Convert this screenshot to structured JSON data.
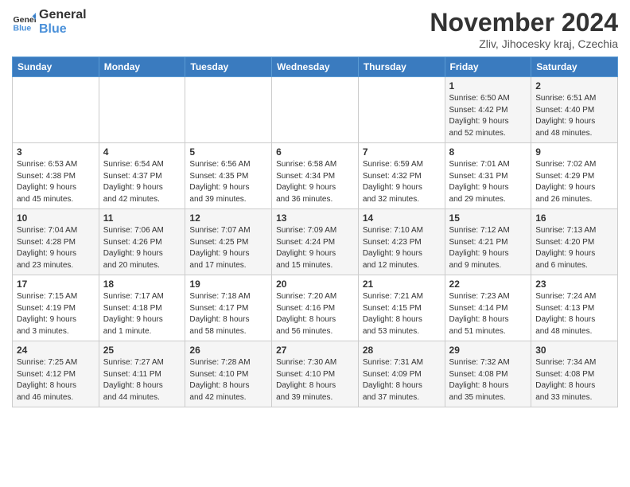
{
  "header": {
    "logo_line1": "General",
    "logo_line2": "Blue",
    "month": "November 2024",
    "location": "Zliv, Jihocesky kraj, Czechia"
  },
  "weekdays": [
    "Sunday",
    "Monday",
    "Tuesday",
    "Wednesday",
    "Thursday",
    "Friday",
    "Saturday"
  ],
  "weeks": [
    [
      {
        "day": "",
        "info": ""
      },
      {
        "day": "",
        "info": ""
      },
      {
        "day": "",
        "info": ""
      },
      {
        "day": "",
        "info": ""
      },
      {
        "day": "",
        "info": ""
      },
      {
        "day": "1",
        "info": "Sunrise: 6:50 AM\nSunset: 4:42 PM\nDaylight: 9 hours\nand 52 minutes."
      },
      {
        "day": "2",
        "info": "Sunrise: 6:51 AM\nSunset: 4:40 PM\nDaylight: 9 hours\nand 48 minutes."
      }
    ],
    [
      {
        "day": "3",
        "info": "Sunrise: 6:53 AM\nSunset: 4:38 PM\nDaylight: 9 hours\nand 45 minutes."
      },
      {
        "day": "4",
        "info": "Sunrise: 6:54 AM\nSunset: 4:37 PM\nDaylight: 9 hours\nand 42 minutes."
      },
      {
        "day": "5",
        "info": "Sunrise: 6:56 AM\nSunset: 4:35 PM\nDaylight: 9 hours\nand 39 minutes."
      },
      {
        "day": "6",
        "info": "Sunrise: 6:58 AM\nSunset: 4:34 PM\nDaylight: 9 hours\nand 36 minutes."
      },
      {
        "day": "7",
        "info": "Sunrise: 6:59 AM\nSunset: 4:32 PM\nDaylight: 9 hours\nand 32 minutes."
      },
      {
        "day": "8",
        "info": "Sunrise: 7:01 AM\nSunset: 4:31 PM\nDaylight: 9 hours\nand 29 minutes."
      },
      {
        "day": "9",
        "info": "Sunrise: 7:02 AM\nSunset: 4:29 PM\nDaylight: 9 hours\nand 26 minutes."
      }
    ],
    [
      {
        "day": "10",
        "info": "Sunrise: 7:04 AM\nSunset: 4:28 PM\nDaylight: 9 hours\nand 23 minutes."
      },
      {
        "day": "11",
        "info": "Sunrise: 7:06 AM\nSunset: 4:26 PM\nDaylight: 9 hours\nand 20 minutes."
      },
      {
        "day": "12",
        "info": "Sunrise: 7:07 AM\nSunset: 4:25 PM\nDaylight: 9 hours\nand 17 minutes."
      },
      {
        "day": "13",
        "info": "Sunrise: 7:09 AM\nSunset: 4:24 PM\nDaylight: 9 hours\nand 15 minutes."
      },
      {
        "day": "14",
        "info": "Sunrise: 7:10 AM\nSunset: 4:23 PM\nDaylight: 9 hours\nand 12 minutes."
      },
      {
        "day": "15",
        "info": "Sunrise: 7:12 AM\nSunset: 4:21 PM\nDaylight: 9 hours\nand 9 minutes."
      },
      {
        "day": "16",
        "info": "Sunrise: 7:13 AM\nSunset: 4:20 PM\nDaylight: 9 hours\nand 6 minutes."
      }
    ],
    [
      {
        "day": "17",
        "info": "Sunrise: 7:15 AM\nSunset: 4:19 PM\nDaylight: 9 hours\nand 3 minutes."
      },
      {
        "day": "18",
        "info": "Sunrise: 7:17 AM\nSunset: 4:18 PM\nDaylight: 9 hours\nand 1 minute."
      },
      {
        "day": "19",
        "info": "Sunrise: 7:18 AM\nSunset: 4:17 PM\nDaylight: 8 hours\nand 58 minutes."
      },
      {
        "day": "20",
        "info": "Sunrise: 7:20 AM\nSunset: 4:16 PM\nDaylight: 8 hours\nand 56 minutes."
      },
      {
        "day": "21",
        "info": "Sunrise: 7:21 AM\nSunset: 4:15 PM\nDaylight: 8 hours\nand 53 minutes."
      },
      {
        "day": "22",
        "info": "Sunrise: 7:23 AM\nSunset: 4:14 PM\nDaylight: 8 hours\nand 51 minutes."
      },
      {
        "day": "23",
        "info": "Sunrise: 7:24 AM\nSunset: 4:13 PM\nDaylight: 8 hours\nand 48 minutes."
      }
    ],
    [
      {
        "day": "24",
        "info": "Sunrise: 7:25 AM\nSunset: 4:12 PM\nDaylight: 8 hours\nand 46 minutes."
      },
      {
        "day": "25",
        "info": "Sunrise: 7:27 AM\nSunset: 4:11 PM\nDaylight: 8 hours\nand 44 minutes."
      },
      {
        "day": "26",
        "info": "Sunrise: 7:28 AM\nSunset: 4:10 PM\nDaylight: 8 hours\nand 42 minutes."
      },
      {
        "day": "27",
        "info": "Sunrise: 7:30 AM\nSunset: 4:10 PM\nDaylight: 8 hours\nand 39 minutes."
      },
      {
        "day": "28",
        "info": "Sunrise: 7:31 AM\nSunset: 4:09 PM\nDaylight: 8 hours\nand 37 minutes."
      },
      {
        "day": "29",
        "info": "Sunrise: 7:32 AM\nSunset: 4:08 PM\nDaylight: 8 hours\nand 35 minutes."
      },
      {
        "day": "30",
        "info": "Sunrise: 7:34 AM\nSunset: 4:08 PM\nDaylight: 8 hours\nand 33 minutes."
      }
    ]
  ]
}
